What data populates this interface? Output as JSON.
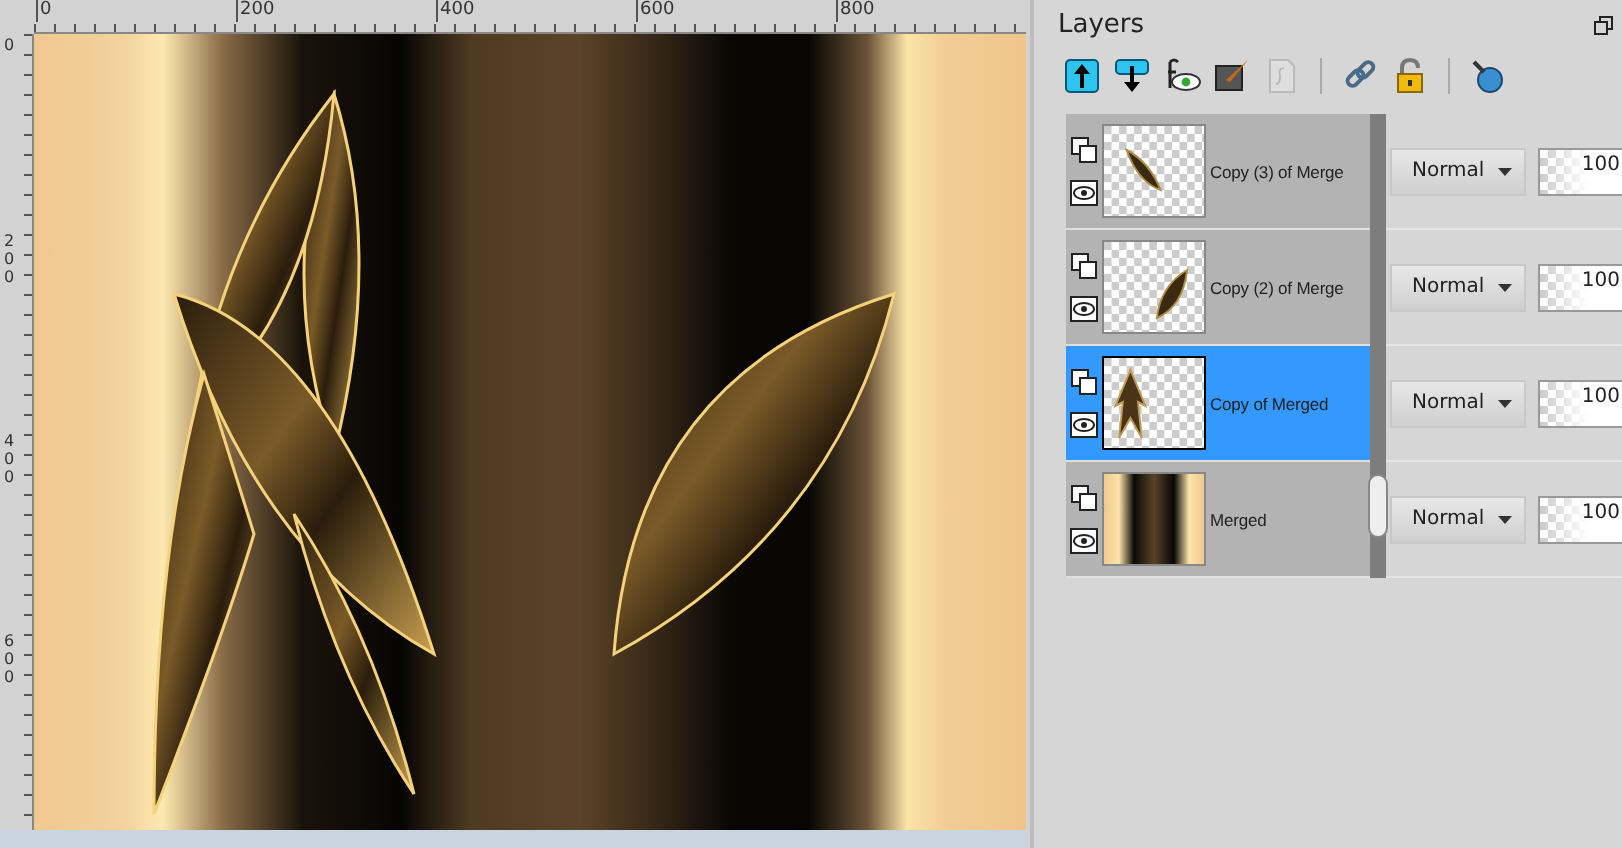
{
  "rulers": {
    "horizontal": [
      "0",
      "200",
      "400",
      "600",
      "800"
    ],
    "vertical": [
      "0",
      "200",
      "400",
      "600"
    ]
  },
  "panel": {
    "title": "Layers"
  },
  "toolbar": [
    {
      "kind": "up",
      "disabled": false
    },
    {
      "kind": "down",
      "disabled": false
    },
    {
      "kind": "eye",
      "disabled": false
    },
    {
      "kind": "brush",
      "disabled": false
    },
    {
      "kind": "page",
      "disabled": true
    },
    {
      "kind": "link",
      "disabled": false
    },
    {
      "kind": "lock",
      "disabled": false
    },
    {
      "kind": "pin",
      "disabled": false
    }
  ],
  "layers": [
    {
      "name": "Copy (3) of Merge",
      "kind": "leaf-left",
      "selected": false,
      "blend": "Normal",
      "opacity": "100"
    },
    {
      "name": "Copy (2) of Merge",
      "kind": "leaf-right",
      "selected": false,
      "blend": "Normal",
      "opacity": "100"
    },
    {
      "name": "Copy of Merged",
      "kind": "spike",
      "selected": true,
      "blend": "Normal",
      "opacity": "100"
    },
    {
      "name": "Merged",
      "kind": "stripes",
      "selected": false,
      "blend": "Normal",
      "opacity": "100"
    }
  ]
}
